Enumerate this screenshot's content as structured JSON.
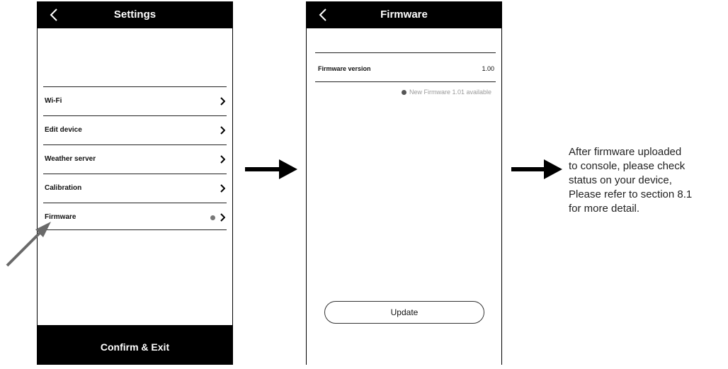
{
  "settings_screen": {
    "title": "Settings",
    "back_icon": "chevron-left-icon",
    "items": [
      {
        "label": "Wi-Fi",
        "icon": "chevron-right-icon"
      },
      {
        "label": "Edit device",
        "icon": "chevron-right-icon"
      },
      {
        "label": "Weather server",
        "icon": "chevron-right-icon"
      },
      {
        "label": "Calibration",
        "icon": "chevron-right-icon"
      },
      {
        "label": "Firmware",
        "icon": "chevron-right-icon",
        "has_indicator_dot": true
      }
    ],
    "confirm_label": "Confirm & Exit"
  },
  "firmware_screen": {
    "title": "Firmware",
    "back_icon": "chevron-left-icon",
    "version_label": "Firmware version",
    "version_value": "1.00",
    "notice": "New Firmware 1.01 available",
    "update_label": "Update"
  },
  "annotation": {
    "lines": [
      "After firmware uploaded",
      "to console, please check",
      "status on your device,",
      "Please refer to section 8.1",
      "for more detail."
    ]
  },
  "colors": {
    "header_bg": "#000000",
    "indicator_dot": "#777777",
    "notice_text": "#9a9a9a",
    "pointer_arrow": "#6a6a6a"
  }
}
